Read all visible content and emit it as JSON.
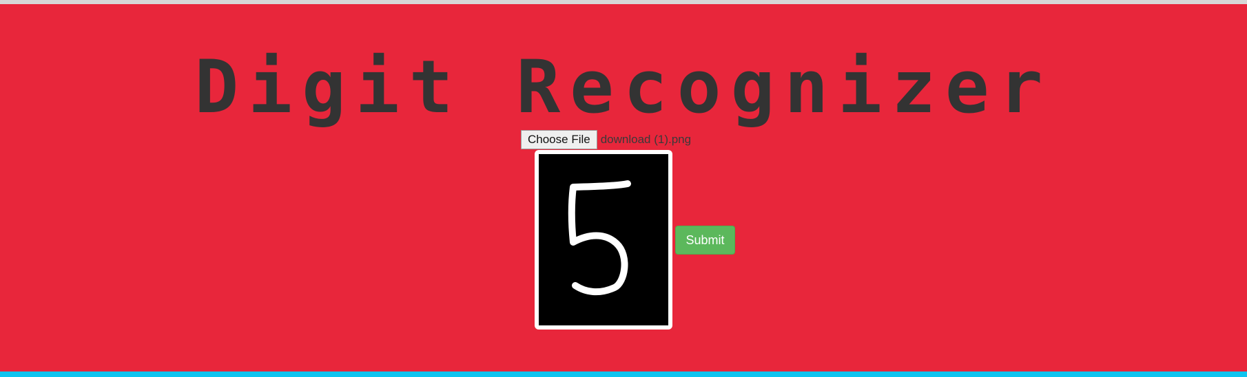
{
  "page": {
    "title": "Digit Recognizer"
  },
  "upload": {
    "choose_label": "Choose File",
    "file_name": "download (1).png"
  },
  "preview": {
    "icon": "handwritten-digit-image"
  },
  "actions": {
    "submit_label": "Submit"
  },
  "colors": {
    "background": "#e8263b",
    "title": "#333333",
    "submit": "#5cb85c",
    "bottom_bar": "#10c4ef"
  }
}
